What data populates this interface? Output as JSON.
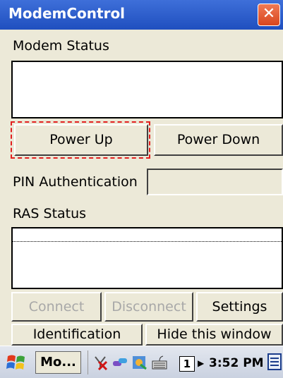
{
  "window": {
    "title": "ModemControl",
    "close_glyph": "✕"
  },
  "modem_status": {
    "label": "Modem Status",
    "value": ""
  },
  "buttons": {
    "power_up": "Power Up",
    "power_down": "Power Down",
    "connect": "Connect",
    "disconnect": "Disconnect",
    "settings": "Settings",
    "identification": "Identification",
    "hide_window": "Hide this window"
  },
  "pin": {
    "label": "PIN Authentication",
    "value": ""
  },
  "ras_status": {
    "label": "RAS Status",
    "value": ""
  },
  "taskbar": {
    "task_button": "Mo...",
    "page_number": "1",
    "clock": "3:52 PM",
    "icons": [
      "start-flag-icon",
      "signal-off-icon",
      "network-icon",
      "app-icon",
      "keyboard-icon",
      "input-panel-icon"
    ]
  },
  "colors": {
    "titlebar": "#1f4fbf",
    "close": "#d8461d",
    "focus": "#e21f1f"
  }
}
